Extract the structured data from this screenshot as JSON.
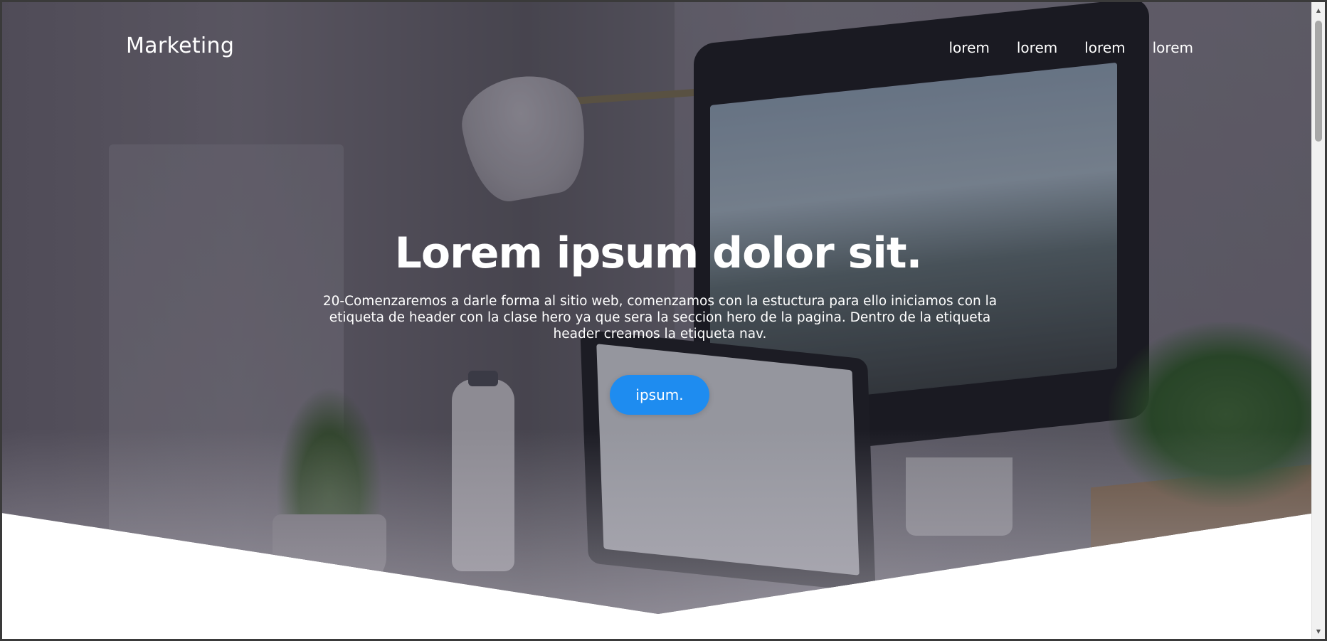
{
  "nav": {
    "brand": "Marketing",
    "links": [
      "lorem",
      "lorem",
      "lorem",
      "lorem"
    ]
  },
  "hero": {
    "title": "Lorem ipsum dolor sit.",
    "text": "20-Comenzaremos a darle forma al sitio web, comenzamos con la estuctura para ello iniciamos con la etiqueta de header con la clase hero ya que sera la seccion hero de la pagina. Dentro de la etiqueta header creamos la etiqueta nav.",
    "button_label": "ipsum."
  },
  "colors": {
    "button": "#1e8cf0",
    "text": "#ffffff",
    "page_background": "#ffffff"
  },
  "icons": {
    "scroll_up": "scroll-up-arrow-icon",
    "scroll_down": "scroll-down-arrow-icon"
  }
}
